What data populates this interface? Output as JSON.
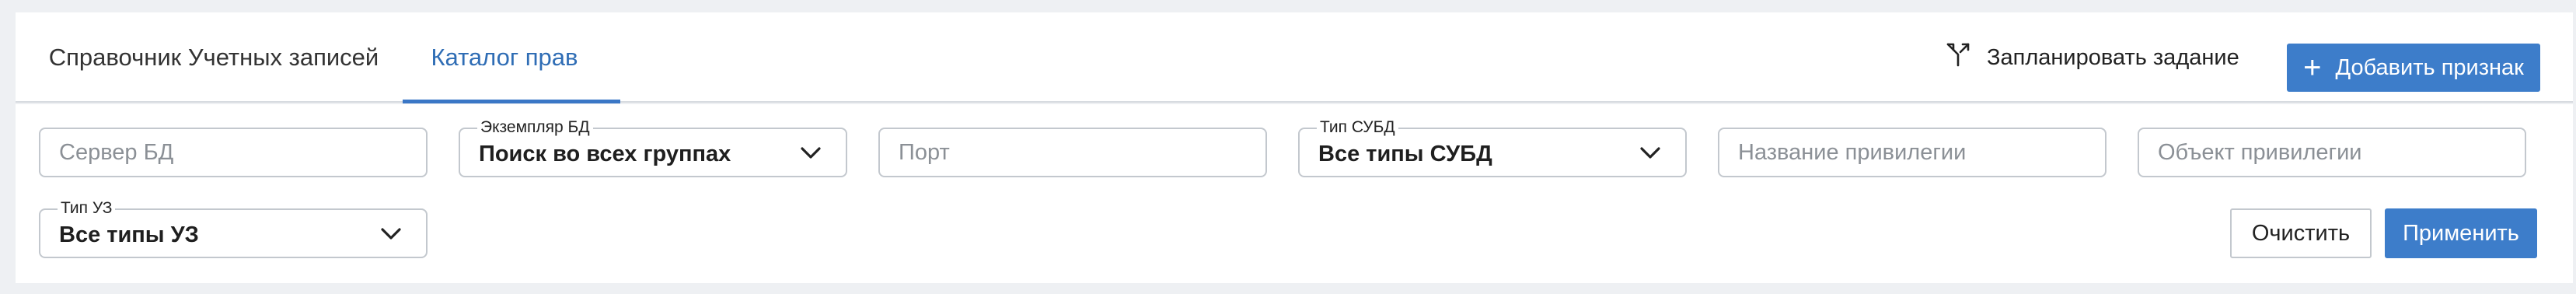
{
  "tabs": [
    {
      "label": "Справочник Учетных записей",
      "active": false
    },
    {
      "label": "Каталог прав",
      "active": true
    }
  ],
  "header_actions": {
    "schedule_label": "Запланировать задание",
    "add_label": "Добавить признак"
  },
  "filters": {
    "db_server": {
      "placeholder": "Сервер БД",
      "value": ""
    },
    "db_instance": {
      "label": "Экземпляр БД",
      "value": "Поиск во всех группах"
    },
    "port": {
      "placeholder": "Порт",
      "value": ""
    },
    "dbms_type": {
      "label": "Тип СУБД",
      "value": "Все типы СУБД"
    },
    "privilege_name": {
      "placeholder": "Название привилегии",
      "value": ""
    },
    "privilege_object": {
      "placeholder": "Объект привилегии",
      "value": ""
    },
    "account_type": {
      "label": "Тип УЗ",
      "value": "Все типы УЗ"
    }
  },
  "filter_actions": {
    "clear_label": "Очистить",
    "apply_label": "Применить"
  },
  "colors": {
    "accent": "#3d7dca",
    "active_tab_text": "#2f6db5",
    "background": "#eef0f3",
    "border": "#c3c8ce"
  },
  "icons": [
    "merge-branch-icon",
    "plus-icon",
    "chevron-down-icon"
  ]
}
